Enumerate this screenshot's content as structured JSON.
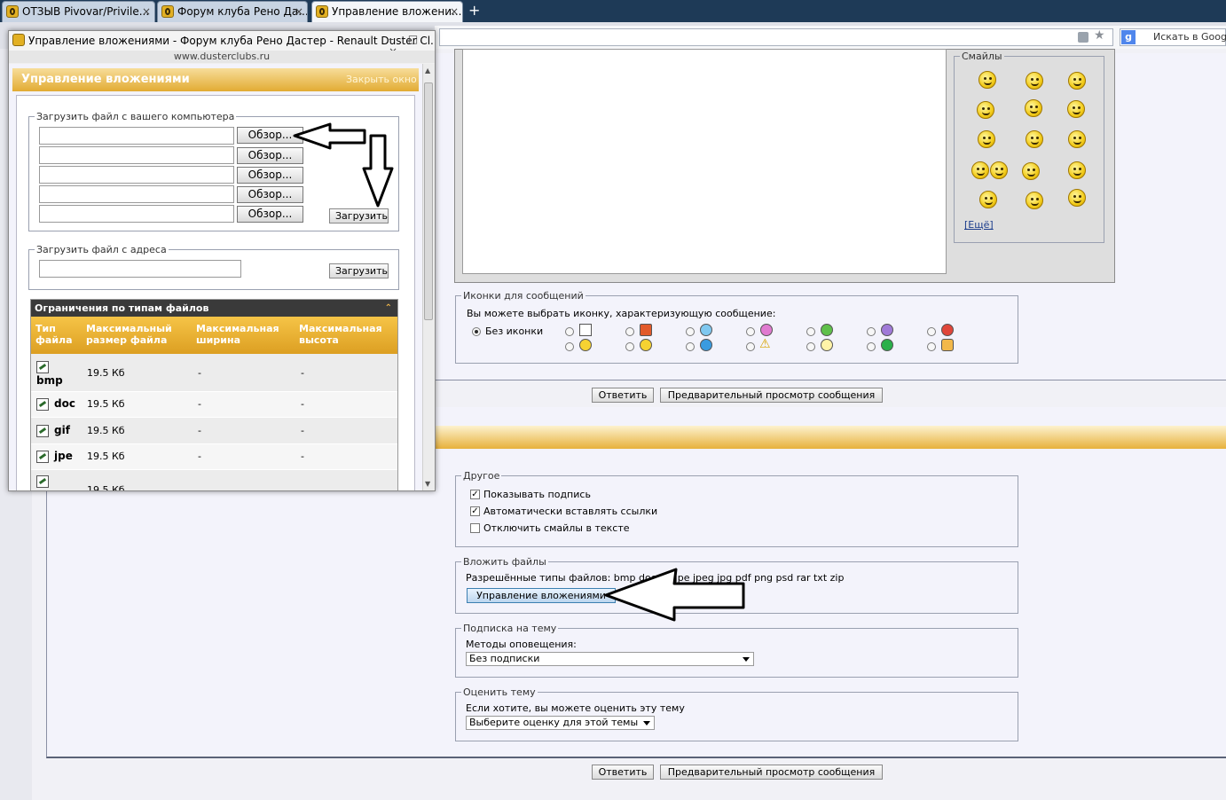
{
  "browser": {
    "tabs": [
      {
        "label": "ОТЗЫВ Pivovar/Privile...",
        "close": "×"
      },
      {
        "label": "Форум клуба Рено Да...",
        "close": "×"
      },
      {
        "label": "Управление вложени...",
        "close": "×"
      }
    ],
    "new_tab": "+",
    "search_placeholder": "Искать в Googl"
  },
  "editor": {
    "smilies_legend": "Смайлы",
    "smilies_more": "[Ещё]"
  },
  "message_icons": {
    "legend": "Иконки для сообщений",
    "prompt": "Вы можете выбрать иконку, характеризующую сообщение:",
    "no_icon": "Без иконки"
  },
  "buttons": {
    "reply": "Ответить",
    "preview": "Предварительный просмотр сообщения"
  },
  "other": {
    "legend": "Другое",
    "options": [
      {
        "label": "Показывать подпись",
        "checked": true
      },
      {
        "label": "Автоматически вставлять ссылки",
        "checked": true
      },
      {
        "label": "Отключить смайлы в тексте",
        "checked": false
      }
    ]
  },
  "attach": {
    "legend": "Вложить файлы",
    "allowed": "Разрешённые типы файлов: bmp doc gif jpe jpeg jpg pdf png psd rar txt zip",
    "manage_button": "Управление вложениями"
  },
  "subscription": {
    "legend": "Подписка на тему",
    "label": "Методы оповещения:",
    "selected": "Без подписки"
  },
  "rating": {
    "legend": "Оценить тему",
    "label": "Если хотите, вы можете оценить эту тему",
    "selected": "Выберите оценку для этой темы"
  },
  "popup": {
    "window_title": "Управление вложениями - Форум клуба Рено Дастер - Renault Duster Cl...",
    "window_controls": "– □ ×",
    "url": "www.dusterclubs.ru",
    "header_title": "Управление вложениями",
    "close_window": "Закрыть окно",
    "upload_legend": "Загрузить файл с вашего компьютера",
    "browse_label": "Обзор...",
    "upload_button": "Загрузить",
    "url_legend": "Загрузить файл с адреса",
    "limits_title": "Ограничения по типам файлов",
    "columns": [
      "Тип файла",
      "Максимальный размер файла",
      "Максимальная ширина",
      "Максимальная высота"
    ],
    "rows": [
      {
        "type": "bmp",
        "size": "19.5 Кб",
        "width": "-",
        "height": "-"
      },
      {
        "type": "doc",
        "size": "19.5 Кб",
        "width": "-",
        "height": "-"
      },
      {
        "type": "gif",
        "size": "19.5 Кб",
        "width": "-",
        "height": "-"
      },
      {
        "type": "jpe",
        "size": "19.5 Кб",
        "width": "-",
        "height": "-"
      },
      {
        "type": "",
        "size": "19.5 Кб",
        "width": "",
        "height": ""
      }
    ]
  },
  "colors": {
    "accent_gold": "#e2ab33",
    "tab_bar": "#1e3a57",
    "table_header": "#3a3a3a"
  }
}
